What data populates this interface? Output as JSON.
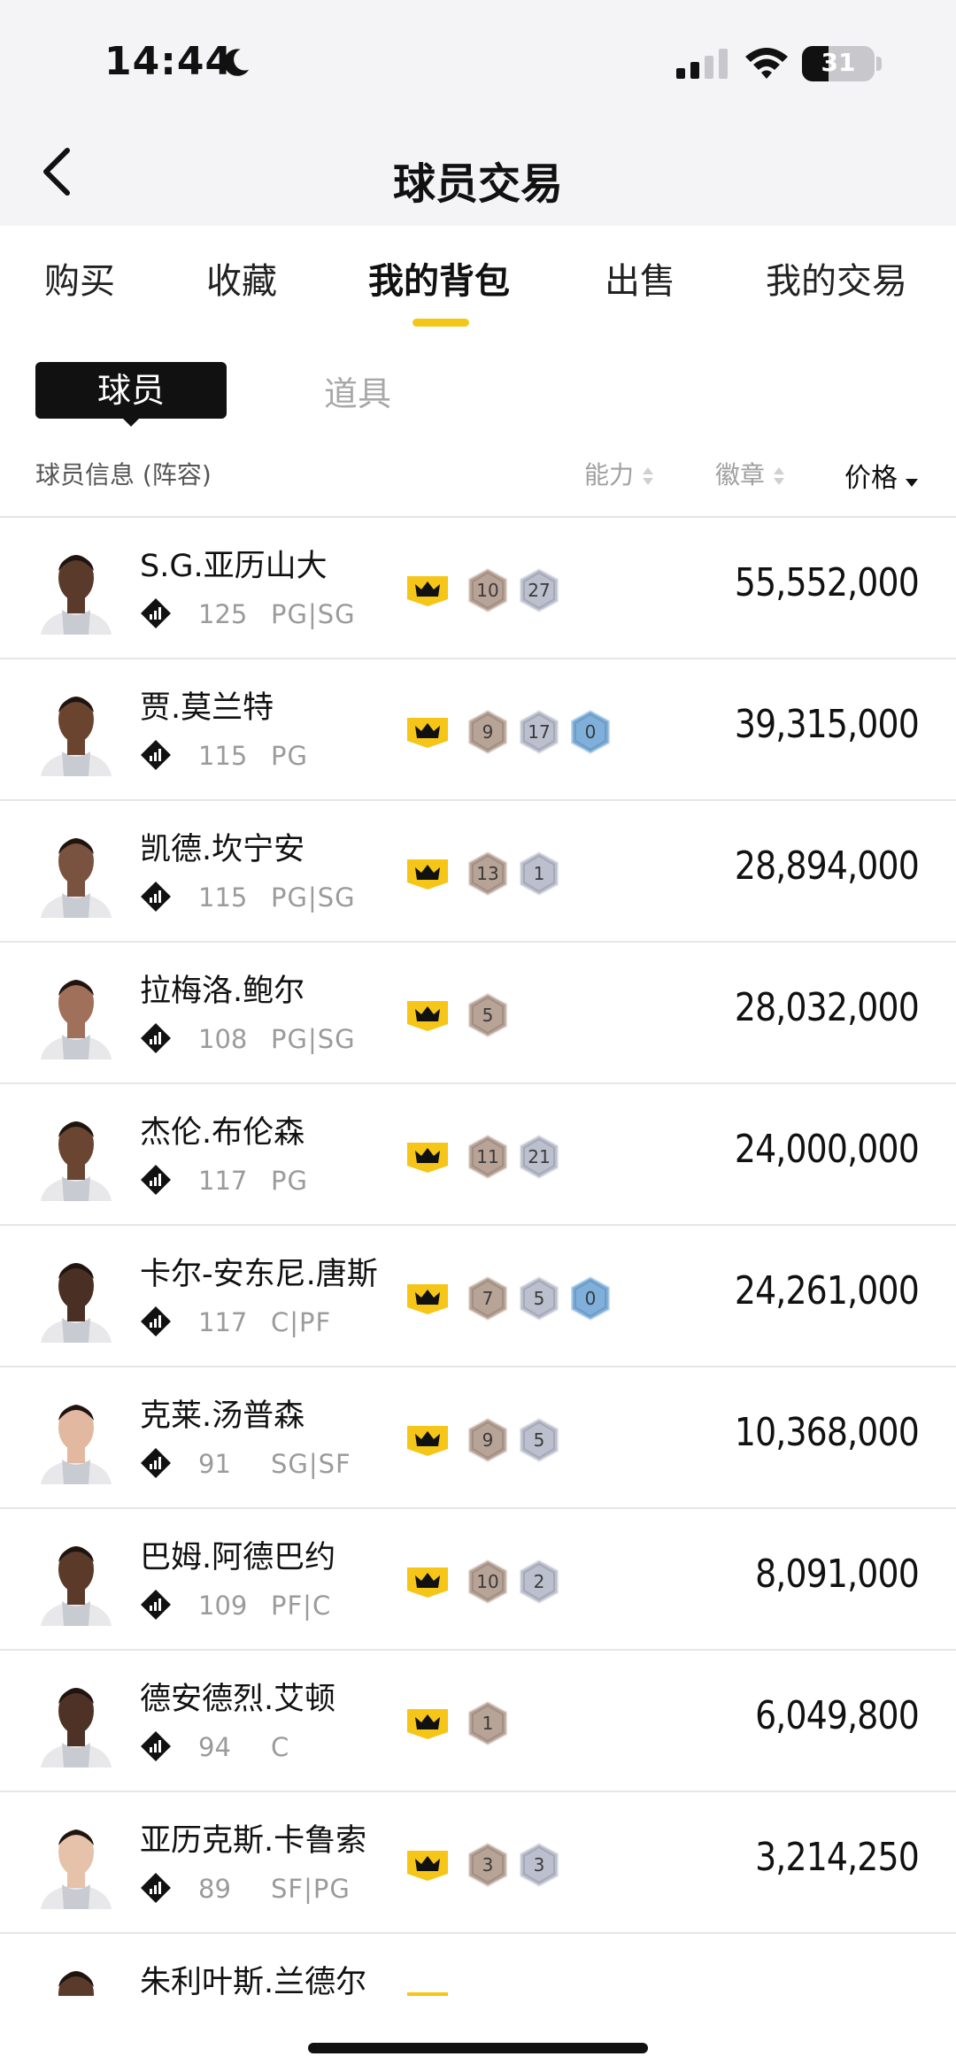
{
  "status_bar": {
    "time": "14:44",
    "battery": "31"
  },
  "header": {
    "title": "球员交易"
  },
  "tabs": [
    {
      "label": "购买"
    },
    {
      "label": "收藏"
    },
    {
      "label": "我的背包"
    },
    {
      "label": "出售"
    },
    {
      "label": "我的交易"
    }
  ],
  "subtabs": {
    "active": "球员",
    "inactive": "道具"
  },
  "columns": {
    "info": "球员信息 (阵容)",
    "ability": "能力",
    "badge": "徽章",
    "price": "价格"
  },
  "players": [
    {
      "name": "S.G.亚历山大",
      "rating": "125",
      "pos": "PG|SG",
      "badges": [
        "10",
        "27"
      ],
      "price": "55,552,000"
    },
    {
      "name": "贾.莫兰特",
      "rating": "115",
      "pos": "PG",
      "badges": [
        "9",
        "17",
        "0"
      ],
      "price": "39,315,000"
    },
    {
      "name": "凯德.坎宁安",
      "rating": "115",
      "pos": "PG|SG",
      "badges": [
        "13",
        "1"
      ],
      "price": "28,894,000"
    },
    {
      "name": "拉梅洛.鲍尔",
      "rating": "108",
      "pos": "PG|SG",
      "badges": [
        "5"
      ],
      "price": "28,032,000"
    },
    {
      "name": "杰伦.布伦森",
      "rating": "117",
      "pos": "PG",
      "badges": [
        "11",
        "21"
      ],
      "price": "24,000,000"
    },
    {
      "name": "卡尔-安东尼.唐斯",
      "rating": "117",
      "pos": "C|PF",
      "badges": [
        "7",
        "5",
        "0"
      ],
      "price": "24,261,000"
    },
    {
      "name": "克莱.汤普森",
      "rating": "91",
      "pos": "SG|SF",
      "badges": [
        "9",
        "5"
      ],
      "price": "10,368,000"
    },
    {
      "name": "巴姆.阿德巴约",
      "rating": "109",
      "pos": "PF|C",
      "badges": [
        "10",
        "2"
      ],
      "price": "8,091,000"
    },
    {
      "name": "德安德烈.艾顿",
      "rating": "94",
      "pos": "C",
      "badges": [
        "1"
      ],
      "price": "6,049,800"
    },
    {
      "name": "亚历克斯.卡鲁索",
      "rating": "89",
      "pos": "SF|PG",
      "badges": [
        "3",
        "3"
      ],
      "price": "3,214,250"
    },
    {
      "name": "朱利叶斯.兰德尔",
      "rating": "",
      "pos": "",
      "badges": [],
      "price": ""
    }
  ],
  "colors": {
    "accent": "#f5c518",
    "badge_bronze": "#b8a397",
    "badge_silver": "#bcc0ce",
    "badge_blue": "#7fb0dc"
  },
  "icons": [
    "moon-icon",
    "signal-icon",
    "wifi-icon",
    "battery-icon",
    "back-arrow-icon",
    "sort-icon",
    "rank-icon",
    "crown-icon",
    "badge-hex-icon"
  ]
}
